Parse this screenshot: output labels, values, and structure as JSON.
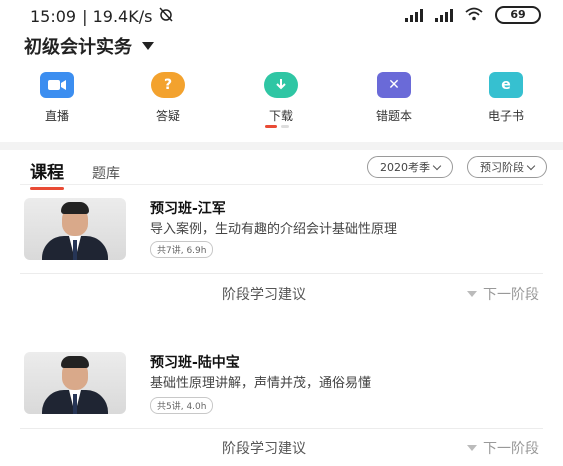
{
  "status_bar": {
    "time": "15:09",
    "speed": "| 19.4K/s",
    "alarm_icon": "alarm-off-icon",
    "battery": "69"
  },
  "header": {
    "title": "初级会计实务"
  },
  "nav": [
    {
      "label": "直播",
      "icon": "live-video-icon",
      "color": "#3c8ef0"
    },
    {
      "label": "答疑",
      "icon": "question-icon",
      "color": "#f3a22e"
    },
    {
      "label": "下载",
      "icon": "download-icon",
      "color": "#2fc6a4"
    },
    {
      "label": "错题本",
      "icon": "error-book-icon",
      "color": "#6a6ad8"
    },
    {
      "label": "电子书",
      "icon": "ebook-icon",
      "color": "#36c0d0"
    }
  ],
  "tabs": [
    {
      "label": "课程",
      "active": true
    },
    {
      "label": "题库",
      "active": false
    }
  ],
  "filters": {
    "season": "2020考季",
    "stage": "预习阶段"
  },
  "courses": [
    {
      "title": "预习班-江军",
      "desc": "导入案例，生动有趣的介绍会计基础性原理",
      "badge": "共7讲, 6.9h"
    },
    {
      "title": "预习班-陆中宝",
      "desc": "基础性原理讲解，声情并茂，通俗易懂",
      "badge": "共5讲, 4.0h"
    }
  ],
  "footer": {
    "advice": "阶段学习建议",
    "next": "下一阶段"
  }
}
